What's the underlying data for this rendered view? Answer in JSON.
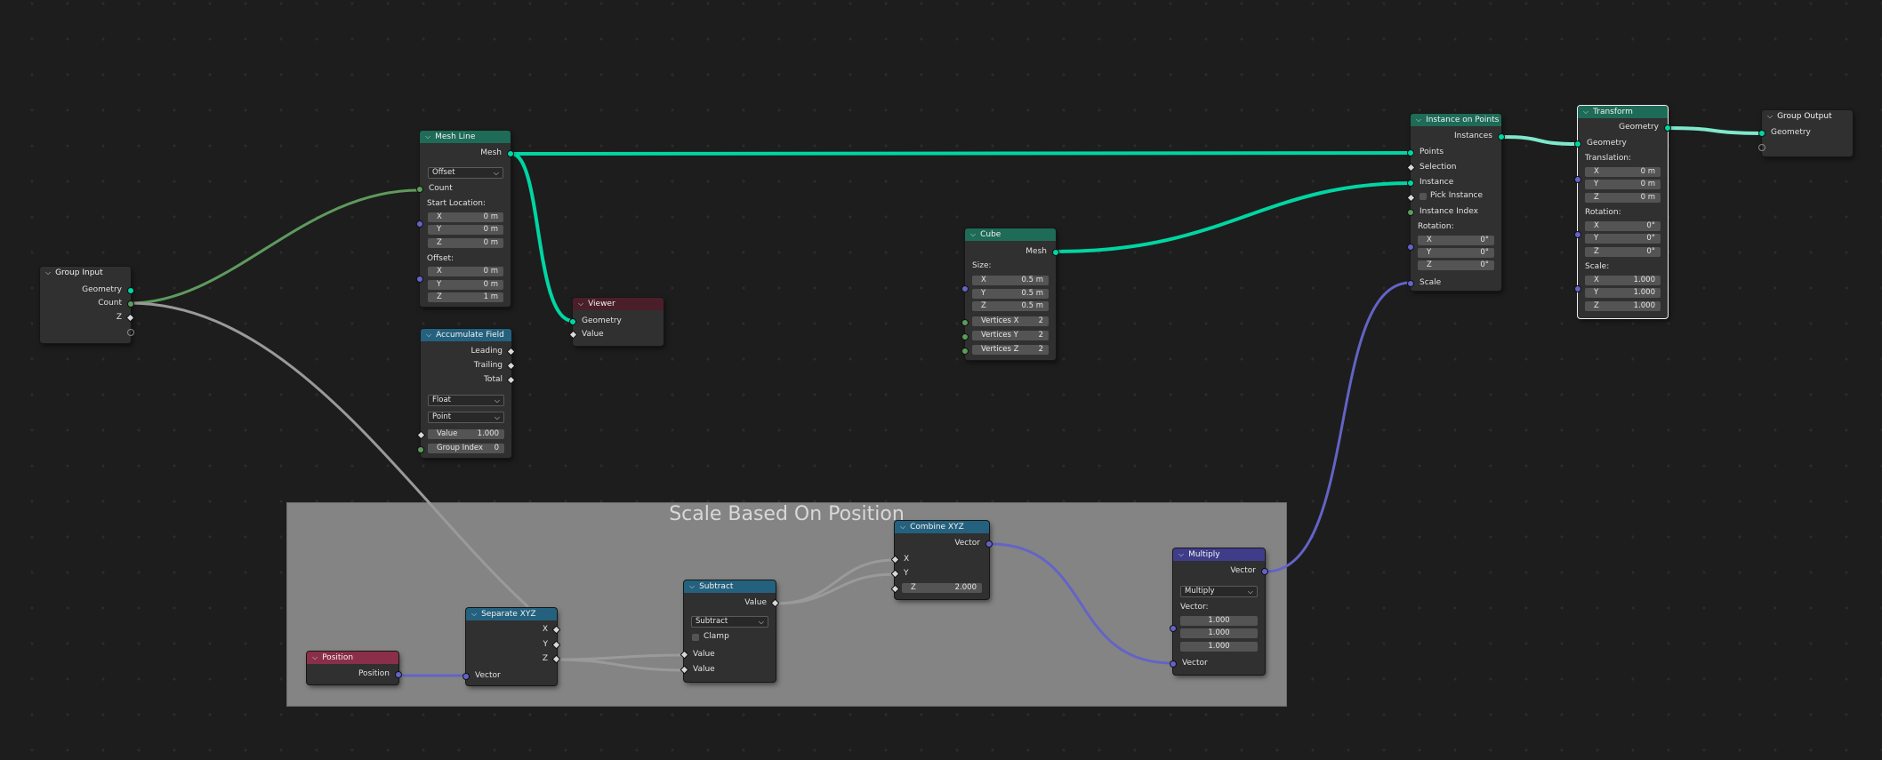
{
  "frame": {
    "label": "Scale Based On Position"
  },
  "colors": {
    "geometry": "#00d6a3",
    "integer": "#5a9c5a",
    "vector": "#6463c7",
    "float": "#a1a1a1"
  },
  "group_input": {
    "title": "Group Input",
    "outputs": [
      "Geometry",
      "Count",
      "Z"
    ]
  },
  "mesh_line": {
    "title": "Mesh Line",
    "output": "Mesh",
    "mode": "Offset",
    "count_label": "Count",
    "start_label": "Start Location:",
    "start": [
      {
        "k": "X",
        "v": "0 m"
      },
      {
        "k": "Y",
        "v": "0 m"
      },
      {
        "k": "Z",
        "v": "0 m"
      }
    ],
    "offset_label": "Offset:",
    "offset": [
      {
        "k": "X",
        "v": "0 m"
      },
      {
        "k": "Y",
        "v": "0 m"
      },
      {
        "k": "Z",
        "v": "1 m"
      }
    ]
  },
  "viewer": {
    "title": "Viewer",
    "inputs": [
      "Geometry",
      "Value"
    ]
  },
  "accumulate": {
    "title": "Accumulate Field",
    "outputs": [
      "Leading",
      "Trailing",
      "Total"
    ],
    "type": "Float",
    "domain": "Point",
    "value_label": "Value",
    "value": "1.000",
    "group_label": "Group Index",
    "group": "0"
  },
  "cube": {
    "title": "Cube",
    "output": "Mesh",
    "size_label": "Size:",
    "size": [
      {
        "k": "X",
        "v": "0.5 m"
      },
      {
        "k": "Y",
        "v": "0.5 m"
      },
      {
        "k": "Z",
        "v": "0.5 m"
      }
    ],
    "verts": [
      {
        "k": "Vertices X",
        "v": "2"
      },
      {
        "k": "Vertices Y",
        "v": "2"
      },
      {
        "k": "Vertices Z",
        "v": "2"
      }
    ]
  },
  "iop": {
    "title": "Instance on Points",
    "output": "Instances",
    "points": "Points",
    "selection": "Selection",
    "instance": "Instance",
    "pick": "Pick Instance",
    "index": "Instance Index",
    "rot_label": "Rotation:",
    "rot": [
      {
        "k": "X",
        "v": "0°"
      },
      {
        "k": "Y",
        "v": "0°"
      },
      {
        "k": "Z",
        "v": "0°"
      }
    ],
    "scale": "Scale"
  },
  "transform": {
    "title": "Transform",
    "output": "Geometry",
    "input": "Geometry",
    "trans_label": "Translation:",
    "trans": [
      {
        "k": "X",
        "v": "0 m"
      },
      {
        "k": "Y",
        "v": "0 m"
      },
      {
        "k": "Z",
        "v": "0 m"
      }
    ],
    "rot_label": "Rotation:",
    "rot": [
      {
        "k": "X",
        "v": "0°"
      },
      {
        "k": "Y",
        "v": "0°"
      },
      {
        "k": "Z",
        "v": "0°"
      }
    ],
    "scale_label": "Scale:",
    "scale": [
      {
        "k": "X",
        "v": "1.000"
      },
      {
        "k": "Y",
        "v": "1.000"
      },
      {
        "k": "Z",
        "v": "1.000"
      }
    ]
  },
  "group_output": {
    "title": "Group Output",
    "input": "Geometry"
  },
  "position": {
    "title": "Position",
    "output": "Position"
  },
  "separate": {
    "title": "Separate XYZ",
    "outputs": [
      "X",
      "Y",
      "Z"
    ],
    "input": "Vector"
  },
  "subtract": {
    "title": "Subtract",
    "output": "Value",
    "op": "Subtract",
    "clamp": "Clamp",
    "inputs": [
      "Value",
      "Value"
    ]
  },
  "combine": {
    "title": "Combine XYZ",
    "output": "Vector",
    "inputs": [
      "X",
      "Y"
    ],
    "z_label": "Z",
    "z": "2.000"
  },
  "multiply": {
    "title": "Multiply",
    "output": "Vector",
    "op": "Multiply",
    "vec_label": "Vector:",
    "vals": [
      "1.000",
      "1.000",
      "1.000"
    ],
    "input": "Vector"
  }
}
